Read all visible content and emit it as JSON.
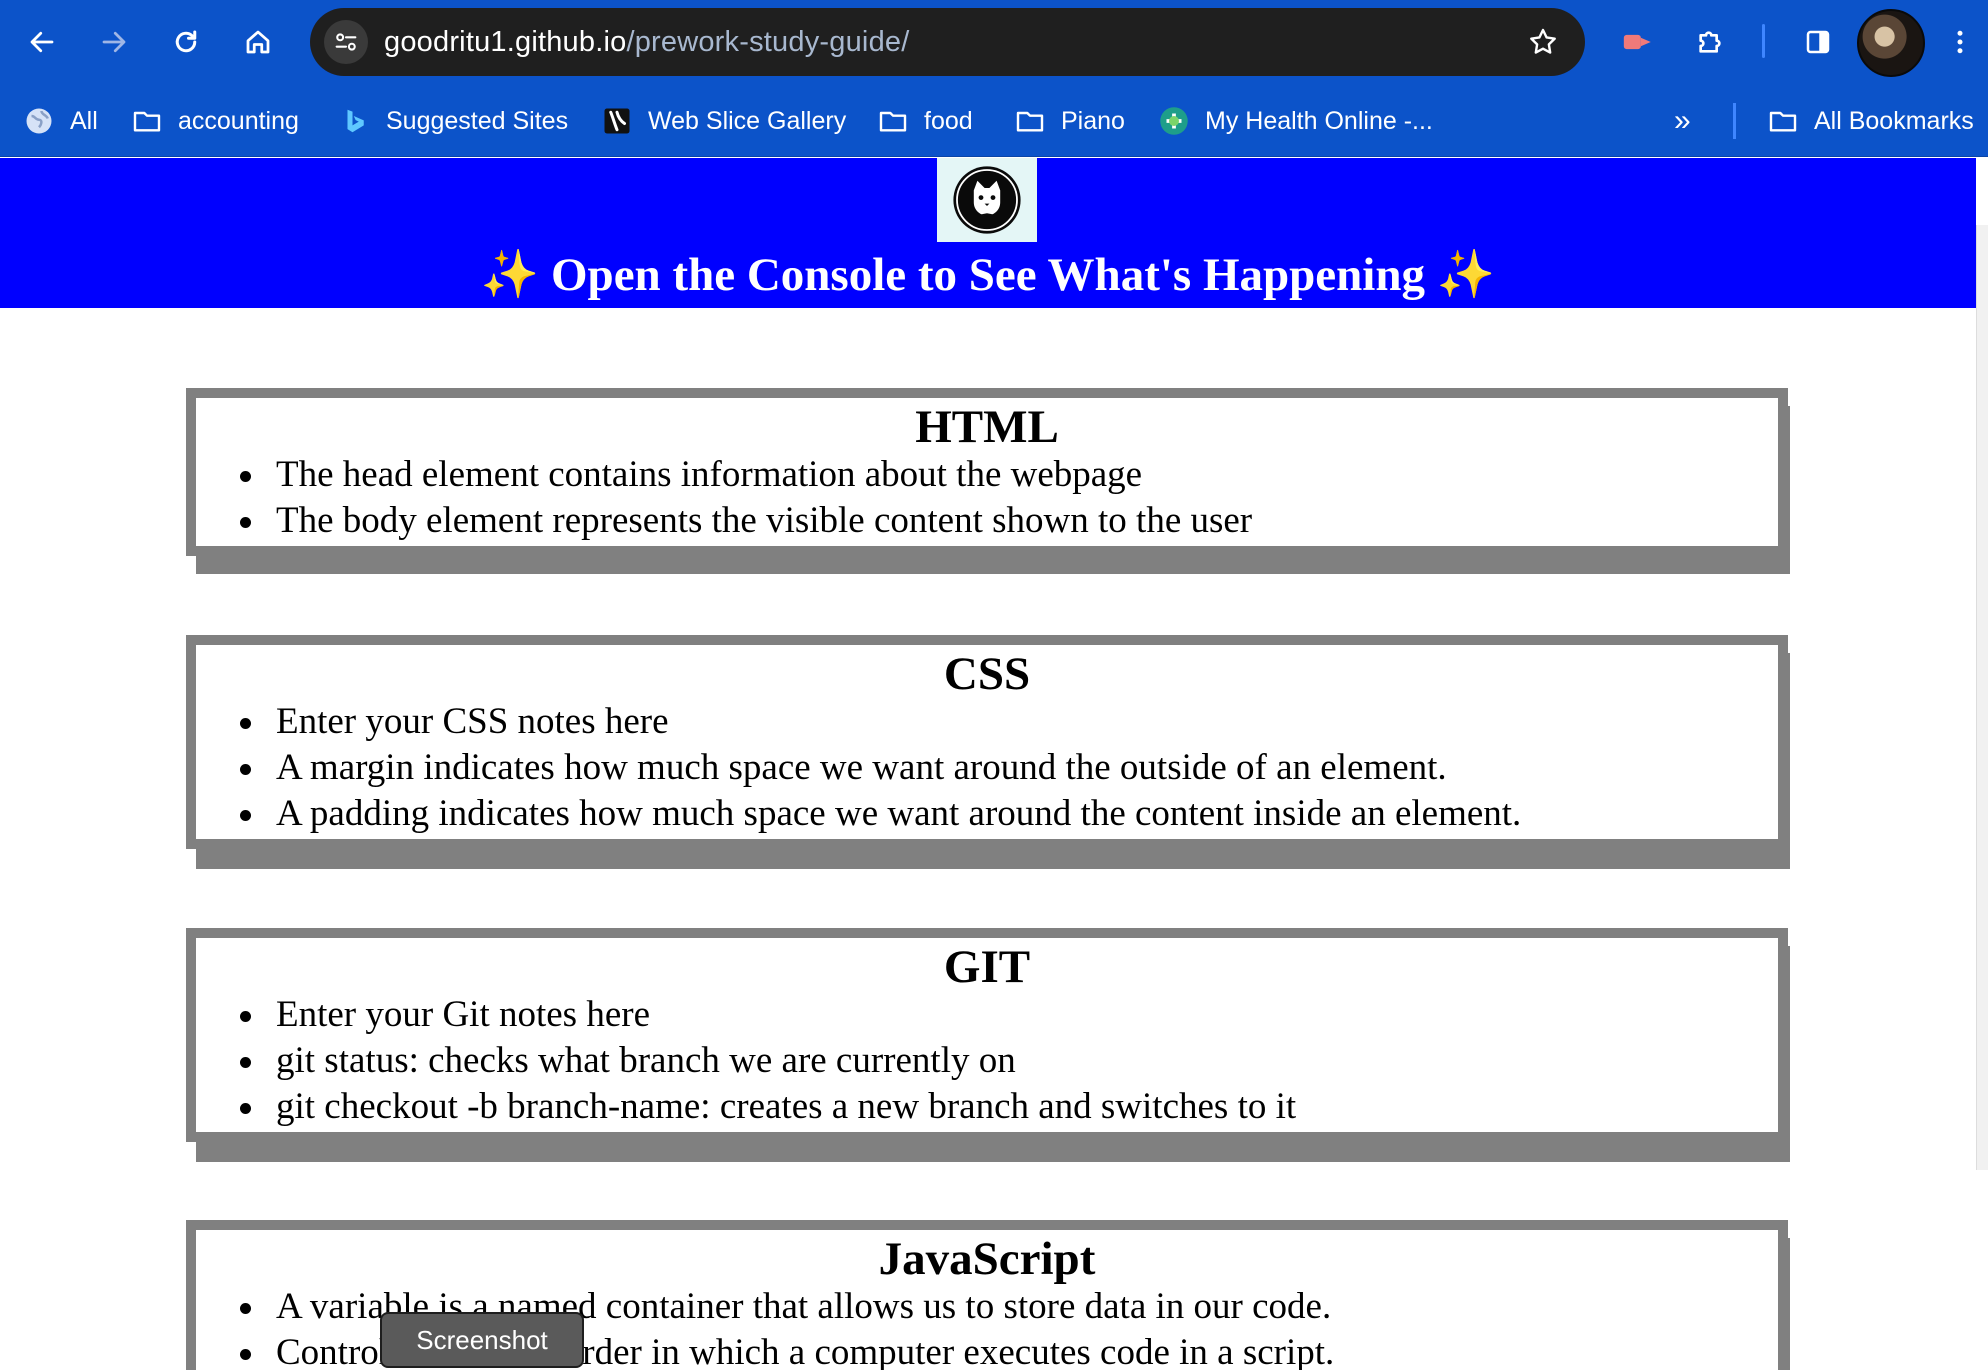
{
  "browser": {
    "url_host": "goodritu1.github.io",
    "url_path": "/prework-study-guide/",
    "colors": {
      "toolbar": "#0c53c9",
      "omnibox": "#1f1f1f"
    },
    "icons": [
      "back-icon",
      "forward-icon",
      "reload-icon",
      "home-icon",
      "site-info-icon",
      "bookmark-star-icon",
      "extension-action-icon",
      "extensions-puzzle-icon",
      "side-panel-icon",
      "profile-avatar",
      "menu-kebab-icon"
    ]
  },
  "bookmarks": {
    "items": [
      {
        "label": "All",
        "icon": "globe-icon"
      },
      {
        "label": "accounting",
        "icon": "folder-icon"
      },
      {
        "label": "Suggested Sites",
        "icon": "bing-icon"
      },
      {
        "label": "Web Slice Gallery",
        "icon": "web-slice-icon"
      },
      {
        "label": "food",
        "icon": "folder-icon"
      },
      {
        "label": "Piano",
        "icon": "folder-icon"
      },
      {
        "label": "My Health Online -...",
        "icon": "health-icon"
      }
    ],
    "overflow": "»",
    "all_bookmarks": "All Bookmarks"
  },
  "page": {
    "header_title": "Open the Console to See What's Happening",
    "sparkle": "✨",
    "colors": {
      "hero": "#0000ff",
      "card_border": "#808080"
    },
    "sections": [
      {
        "title": "HTML",
        "items": [
          "The head element contains information about the webpage",
          "The body element represents the visible content shown to the user"
        ]
      },
      {
        "title": "CSS",
        "items": [
          "Enter your CSS notes here",
          "A margin indicates how much space we want around the outside of an element.",
          "A padding indicates how much space we want around the content inside an element."
        ]
      },
      {
        "title": "GIT",
        "items": [
          "Enter your Git notes here",
          "git status: checks what branch we are currently on",
          "git checkout -b branch-name: creates a new branch and switches to it"
        ]
      },
      {
        "title": "JavaScript",
        "items": [
          "A variable is a named container that allows us to store data in our code.",
          "Control flow is the order in which a computer executes code in a script."
        ]
      }
    ]
  },
  "overlay": {
    "tooltip": "Screenshot"
  }
}
